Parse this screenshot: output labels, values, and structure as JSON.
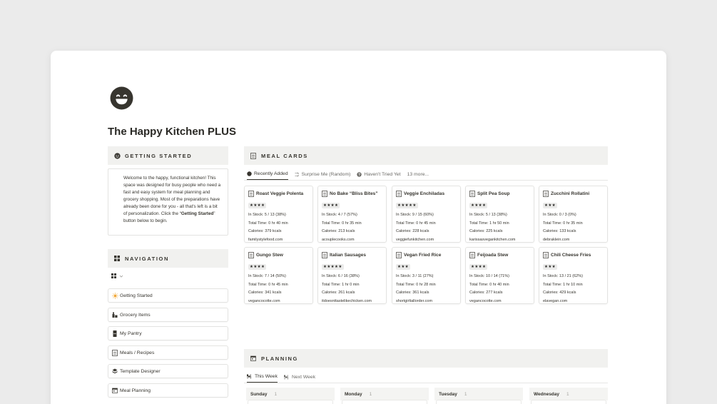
{
  "page": {
    "title": "The Happy Kitchen PLUS",
    "icon": "grinning-face-icon"
  },
  "getting_started": {
    "heading": "GETTING STARTED",
    "text_before": "Welcome to the happy, functional kitchen! This space was designed for busy people who need a fast and easy system for meal planning and grocery shopping. Most of the preparations have already been done for you - all that's left is a bit of personalization. Click the “",
    "text_bold": "Getting Started",
    "text_after": "” button below to begin."
  },
  "navigation": {
    "heading": "NAVIGATION",
    "items": [
      {
        "label": "Getting Started",
        "icon": "sun-icon"
      },
      {
        "label": "Grocery Items",
        "icon": "grocery-icon"
      },
      {
        "label": "My Pantry",
        "icon": "pantry-icon"
      },
      {
        "label": "Meals / Recipes",
        "icon": "document-icon"
      },
      {
        "label": "Template Designer",
        "icon": "layers-icon"
      },
      {
        "label": "Meal Planning",
        "icon": "calendar-icon"
      }
    ]
  },
  "meal_cards": {
    "heading": "MEAL CARDS",
    "tabs": [
      {
        "label": "Recently Added",
        "icon": "circle-icon",
        "active": true
      },
      {
        "label": "Surprise Me (Random)",
        "icon": "shuffle-icon",
        "active": false
      },
      {
        "label": "Haven't Tried Yet",
        "icon": "question-icon",
        "active": false
      },
      {
        "label": "13 more...",
        "icon": "",
        "active": false
      }
    ],
    "cards": [
      {
        "title": "Roast Veggie Polenta",
        "stars": "★★★★",
        "stock": "In Stock: 5 / 13 (38%)",
        "time": "Total Time: 0 hr 40 min",
        "calories": "Calories: 379 kcals",
        "source": "familystylefood.com"
      },
      {
        "title": "No Bake “Bliss Bites”",
        "stars": "★★★★",
        "stock": "In Stock: 4 / 7 (57%)",
        "time": "Total Time: 0 hr 35 min",
        "calories": "Calories: 213 kcals",
        "source": "acouplecooks.com"
      },
      {
        "title": "Veggie Enchiladas",
        "stars": "★★★★★",
        "stock": "In Stock: 9 / 15 (60%)",
        "time": "Total Time: 0 hr 45 min",
        "calories": "Calories: 228 kcals",
        "source": "veggiefunkitchen.com"
      },
      {
        "title": "Split Pea Soup",
        "stars": "★★★★",
        "stock": "In Stock: 5 / 13 (38%)",
        "time": "Total Time: 1 hr 50 min",
        "calories": "Calories: 225 kcals",
        "source": "karissasvegankitchen.com"
      },
      {
        "title": "Zucchini Rollatini",
        "stars": "★★★",
        "stock": "In Stock: 0 / 3 (0%)",
        "time": "Total Time: 0 hr 35 min",
        "calories": "Calories: 133 kcals",
        "source": "debraklein.com"
      },
      {
        "title": "Gungo Stew",
        "stars": "★★★★",
        "stock": "In Stock: 7 / 14 (50%)",
        "time": "Total Time: 0 hr 45 min",
        "calories": "Calories: 341 kcals",
        "source": "vegancocotte.com"
      },
      {
        "title": "Italian Sausages",
        "stars": "★★★★★",
        "stock": "In Stock: 6 / 16 (38%)",
        "time": "Total Time: 1 hr 0 min",
        "calories": "Calories: 261 kcals",
        "source": "itdoesnttastelikechicken.com"
      },
      {
        "title": "Vegan Fried Rice",
        "stars": "★★★",
        "stock": "In Stock: 3 / 11 (27%)",
        "time": "Total Time: 0 hr 28 min",
        "calories": "Calories: 361 kcals",
        "source": "shortgirltallorder.com"
      },
      {
        "title": "Feijoada Stew",
        "stars": "★★★★",
        "stock": "In Stock: 10 / 14 (71%)",
        "time": "Total Time: 0 hr 40 min",
        "calories": "Calories: 277 kcals",
        "source": "vegancocotte.com"
      },
      {
        "title": "Chili Cheese Fries",
        "stars": "★★★",
        "stock": "In Stock: 13 / 21 (62%)",
        "time": "Total Time: 1 hr 10 min",
        "calories": "Calories: 429 kcals",
        "source": "elavegan.com"
      }
    ]
  },
  "planning": {
    "heading": "PLANNING",
    "tabs": [
      {
        "label": "This Week",
        "icon": "utensils-icon",
        "active": true
      },
      {
        "label": "Next Week",
        "icon": "utensils-icon",
        "active": false
      }
    ],
    "days": [
      {
        "name": "Sunday",
        "count": "1"
      },
      {
        "name": "Monday",
        "count": "1"
      },
      {
        "name": "Tuesday",
        "count": "1"
      },
      {
        "name": "Wednesday",
        "count": "1"
      }
    ]
  }
}
